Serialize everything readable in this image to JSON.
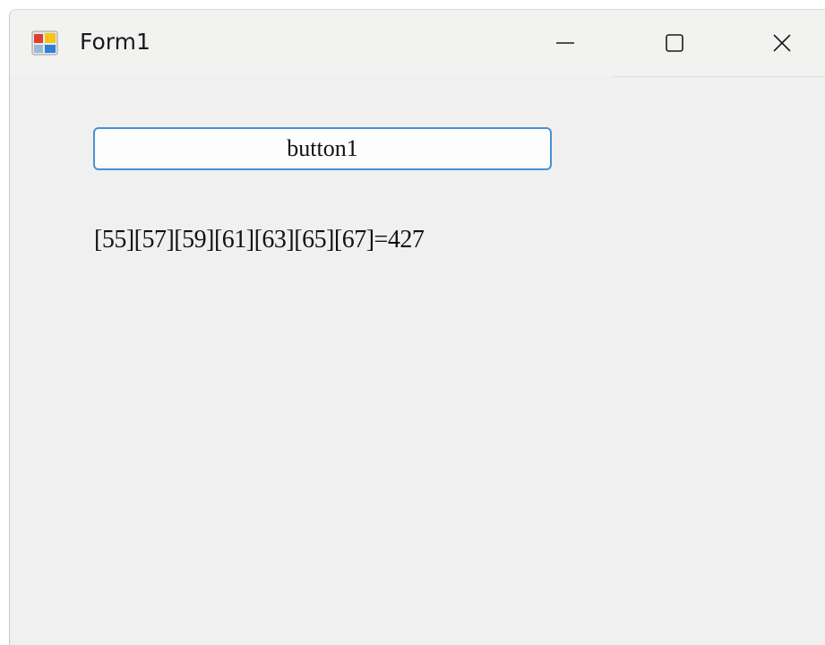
{
  "window": {
    "title": "Form1",
    "icon": "winforms-app-icon",
    "controls": {
      "minimize": "minimize-icon",
      "maximize": "maximize-icon",
      "close": "close-icon"
    }
  },
  "form": {
    "button1_label": "button1",
    "label1_text": "[55][57][59][61][63][65][67]=427"
  },
  "colors": {
    "client_background": "#f0f0f0",
    "titlebar_background": "#f2f3f1",
    "button_border_focus": "#4a90d4"
  }
}
